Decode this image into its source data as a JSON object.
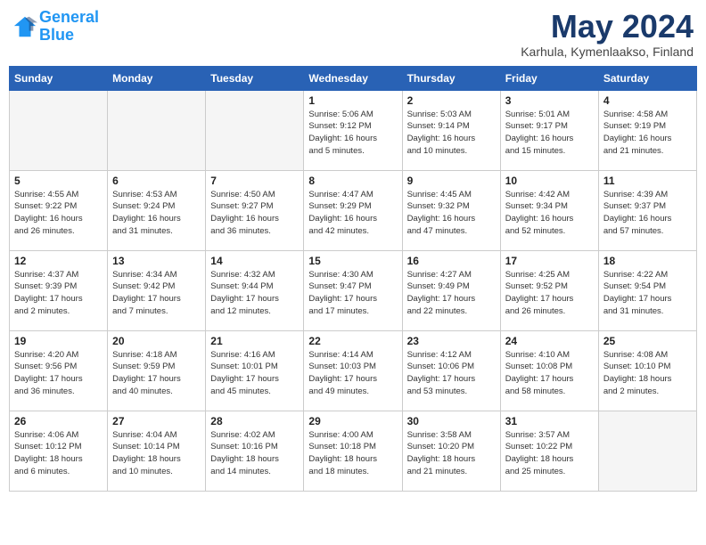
{
  "header": {
    "logo_line1": "General",
    "logo_line2": "Blue",
    "month": "May 2024",
    "location": "Karhula, Kymenlaakso, Finland"
  },
  "days_of_week": [
    "Sunday",
    "Monday",
    "Tuesday",
    "Wednesday",
    "Thursday",
    "Friday",
    "Saturday"
  ],
  "weeks": [
    [
      {
        "num": "",
        "info": "",
        "empty": true
      },
      {
        "num": "",
        "info": "",
        "empty": true
      },
      {
        "num": "",
        "info": "",
        "empty": true
      },
      {
        "num": "1",
        "info": "Sunrise: 5:06 AM\nSunset: 9:12 PM\nDaylight: 16 hours\nand 5 minutes.",
        "empty": false
      },
      {
        "num": "2",
        "info": "Sunrise: 5:03 AM\nSunset: 9:14 PM\nDaylight: 16 hours\nand 10 minutes.",
        "empty": false
      },
      {
        "num": "3",
        "info": "Sunrise: 5:01 AM\nSunset: 9:17 PM\nDaylight: 16 hours\nand 15 minutes.",
        "empty": false
      },
      {
        "num": "4",
        "info": "Sunrise: 4:58 AM\nSunset: 9:19 PM\nDaylight: 16 hours\nand 21 minutes.",
        "empty": false
      }
    ],
    [
      {
        "num": "5",
        "info": "Sunrise: 4:55 AM\nSunset: 9:22 PM\nDaylight: 16 hours\nand 26 minutes.",
        "empty": false
      },
      {
        "num": "6",
        "info": "Sunrise: 4:53 AM\nSunset: 9:24 PM\nDaylight: 16 hours\nand 31 minutes.",
        "empty": false
      },
      {
        "num": "7",
        "info": "Sunrise: 4:50 AM\nSunset: 9:27 PM\nDaylight: 16 hours\nand 36 minutes.",
        "empty": false
      },
      {
        "num": "8",
        "info": "Sunrise: 4:47 AM\nSunset: 9:29 PM\nDaylight: 16 hours\nand 42 minutes.",
        "empty": false
      },
      {
        "num": "9",
        "info": "Sunrise: 4:45 AM\nSunset: 9:32 PM\nDaylight: 16 hours\nand 47 minutes.",
        "empty": false
      },
      {
        "num": "10",
        "info": "Sunrise: 4:42 AM\nSunset: 9:34 PM\nDaylight: 16 hours\nand 52 minutes.",
        "empty": false
      },
      {
        "num": "11",
        "info": "Sunrise: 4:39 AM\nSunset: 9:37 PM\nDaylight: 16 hours\nand 57 minutes.",
        "empty": false
      }
    ],
    [
      {
        "num": "12",
        "info": "Sunrise: 4:37 AM\nSunset: 9:39 PM\nDaylight: 17 hours\nand 2 minutes.",
        "empty": false
      },
      {
        "num": "13",
        "info": "Sunrise: 4:34 AM\nSunset: 9:42 PM\nDaylight: 17 hours\nand 7 minutes.",
        "empty": false
      },
      {
        "num": "14",
        "info": "Sunrise: 4:32 AM\nSunset: 9:44 PM\nDaylight: 17 hours\nand 12 minutes.",
        "empty": false
      },
      {
        "num": "15",
        "info": "Sunrise: 4:30 AM\nSunset: 9:47 PM\nDaylight: 17 hours\nand 17 minutes.",
        "empty": false
      },
      {
        "num": "16",
        "info": "Sunrise: 4:27 AM\nSunset: 9:49 PM\nDaylight: 17 hours\nand 22 minutes.",
        "empty": false
      },
      {
        "num": "17",
        "info": "Sunrise: 4:25 AM\nSunset: 9:52 PM\nDaylight: 17 hours\nand 26 minutes.",
        "empty": false
      },
      {
        "num": "18",
        "info": "Sunrise: 4:22 AM\nSunset: 9:54 PM\nDaylight: 17 hours\nand 31 minutes.",
        "empty": false
      }
    ],
    [
      {
        "num": "19",
        "info": "Sunrise: 4:20 AM\nSunset: 9:56 PM\nDaylight: 17 hours\nand 36 minutes.",
        "empty": false
      },
      {
        "num": "20",
        "info": "Sunrise: 4:18 AM\nSunset: 9:59 PM\nDaylight: 17 hours\nand 40 minutes.",
        "empty": false
      },
      {
        "num": "21",
        "info": "Sunrise: 4:16 AM\nSunset: 10:01 PM\nDaylight: 17 hours\nand 45 minutes.",
        "empty": false
      },
      {
        "num": "22",
        "info": "Sunrise: 4:14 AM\nSunset: 10:03 PM\nDaylight: 17 hours\nand 49 minutes.",
        "empty": false
      },
      {
        "num": "23",
        "info": "Sunrise: 4:12 AM\nSunset: 10:06 PM\nDaylight: 17 hours\nand 53 minutes.",
        "empty": false
      },
      {
        "num": "24",
        "info": "Sunrise: 4:10 AM\nSunset: 10:08 PM\nDaylight: 17 hours\nand 58 minutes.",
        "empty": false
      },
      {
        "num": "25",
        "info": "Sunrise: 4:08 AM\nSunset: 10:10 PM\nDaylight: 18 hours\nand 2 minutes.",
        "empty": false
      }
    ],
    [
      {
        "num": "26",
        "info": "Sunrise: 4:06 AM\nSunset: 10:12 PM\nDaylight: 18 hours\nand 6 minutes.",
        "empty": false
      },
      {
        "num": "27",
        "info": "Sunrise: 4:04 AM\nSunset: 10:14 PM\nDaylight: 18 hours\nand 10 minutes.",
        "empty": false
      },
      {
        "num": "28",
        "info": "Sunrise: 4:02 AM\nSunset: 10:16 PM\nDaylight: 18 hours\nand 14 minutes.",
        "empty": false
      },
      {
        "num": "29",
        "info": "Sunrise: 4:00 AM\nSunset: 10:18 PM\nDaylight: 18 hours\nand 18 minutes.",
        "empty": false
      },
      {
        "num": "30",
        "info": "Sunrise: 3:58 AM\nSunset: 10:20 PM\nDaylight: 18 hours\nand 21 minutes.",
        "empty": false
      },
      {
        "num": "31",
        "info": "Sunrise: 3:57 AM\nSunset: 10:22 PM\nDaylight: 18 hours\nand 25 minutes.",
        "empty": false
      },
      {
        "num": "",
        "info": "",
        "empty": true
      }
    ]
  ]
}
